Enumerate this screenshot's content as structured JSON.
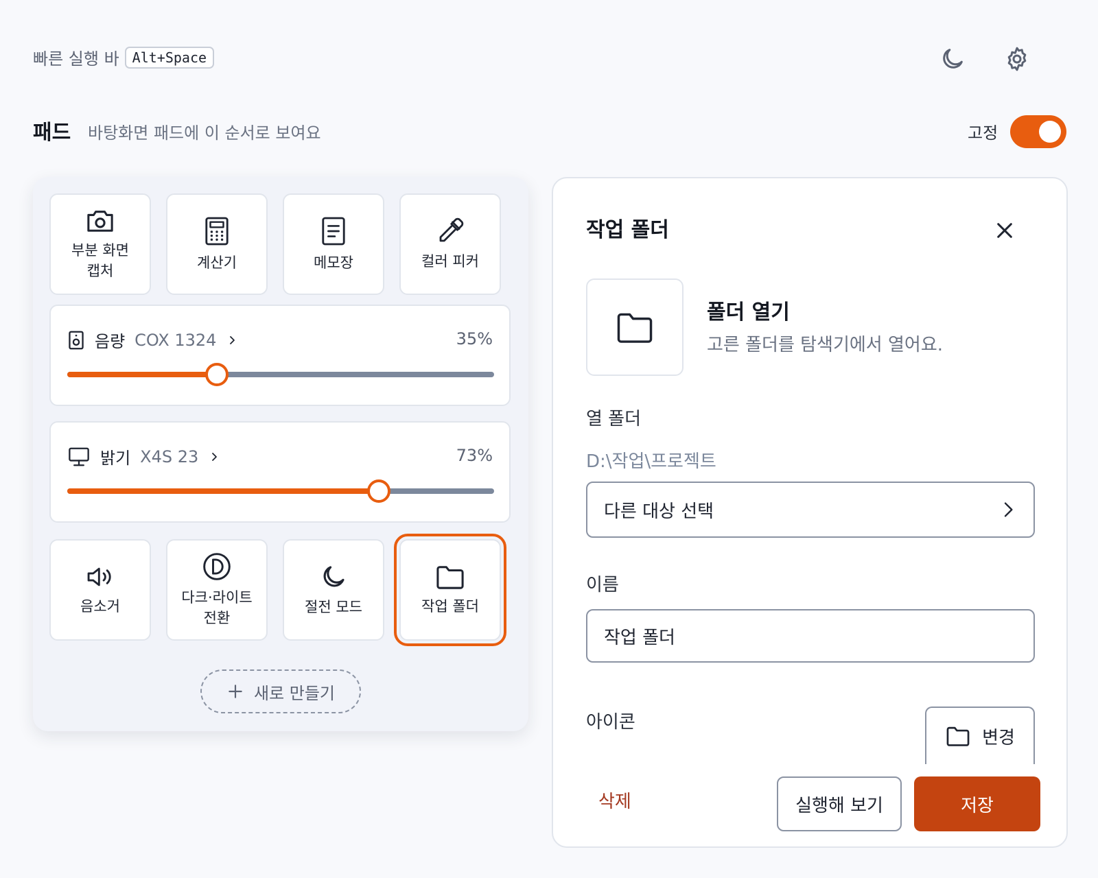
{
  "header": {
    "quickbar_label": "빠른 실행 바",
    "quickbar_shortcut": "Alt+Space",
    "theme_icon": "moon-icon",
    "settings_icon": "gear-icon"
  },
  "pad": {
    "title": "패드",
    "subtitle": "바탕화면 패드에 이 순서로 보여요",
    "pin_label": "고정",
    "pinned": true,
    "tiles_top": [
      {
        "label": "부분 화면\n캡처",
        "icon": "camera-icon"
      },
      {
        "label": "계산기",
        "icon": "calculator-icon"
      },
      {
        "label": "메모장",
        "icon": "notepad-icon"
      },
      {
        "label": "컬러 피커",
        "icon": "eyedropper-icon"
      }
    ],
    "volume": {
      "label": "음량",
      "device": "COX 1324",
      "percent_text": "35%",
      "value": 35,
      "icon": "speaker-icon"
    },
    "brightness": {
      "label": "밝기",
      "device": "X4S 23",
      "percent_text": "73%",
      "value": 73,
      "icon": "monitor-icon"
    },
    "tiles_bottom": [
      {
        "label": "음소거",
        "icon": "volume-icon"
      },
      {
        "label": "다크·라이트\n전환",
        "icon": "contrast-icon"
      },
      {
        "label": "절전 모드",
        "icon": "moon-icon"
      },
      {
        "label": "작업 폴더",
        "icon": "folder-icon",
        "selected": true
      }
    ],
    "new_button": "새로 만들기"
  },
  "detail": {
    "title": "작업 폴더",
    "action_title": "폴더 열기",
    "action_desc": "고른 폴더를 탐색기에서 열어요.",
    "folder_label": "열 폴더",
    "folder_path": "D:\\작업\\프로젝트",
    "choose_other": "다른 대상 선택",
    "name_label": "이름",
    "name_value": "작업 폴더",
    "icon_label": "아이콘",
    "icon_change": "변경",
    "delete": "삭제",
    "test": "실행해 보기",
    "save": "저장"
  },
  "colors": {
    "accent": "#e85d0f",
    "save": "#c44410",
    "delete": "#a43a22"
  }
}
